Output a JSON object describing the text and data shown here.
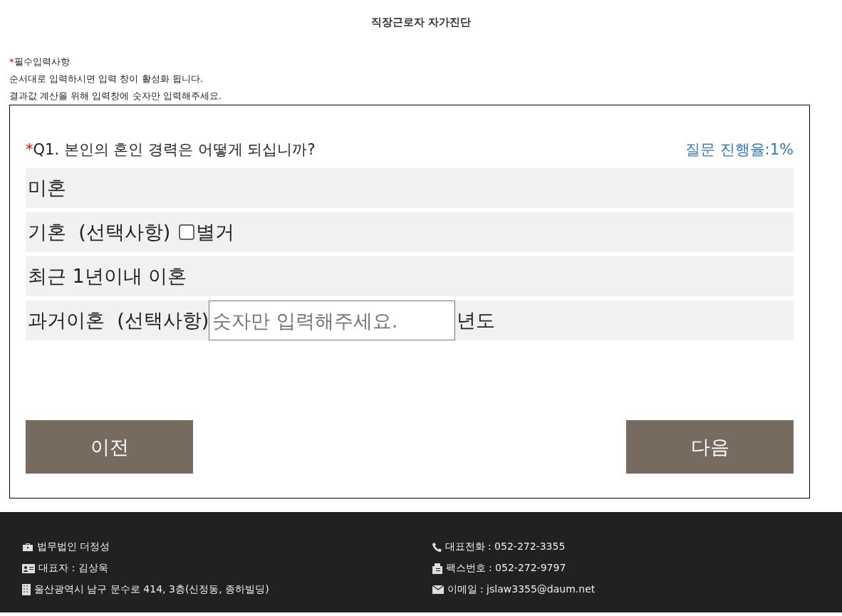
{
  "page_title": "직장근로자 자가진단",
  "notes": {
    "required_mark": "*",
    "required_label": "필수입력사항",
    "lines": [
      "순서대로 입력하시면 입력 창이 활성화 됩니다.",
      "결과값 계산을 위해 입력창에 숫자만 입력해주세요."
    ]
  },
  "question": {
    "required_mark": "*",
    "text": "Q1. 본인의 혼인 경력은 어떻게 되십니까?",
    "progress": "질문 진행율:1%"
  },
  "options": [
    {
      "kind": "plain",
      "label": "미혼"
    },
    {
      "kind": "checkbox",
      "label": "기혼  (선택사항)",
      "checkbox_label": "별거",
      "checked": false
    },
    {
      "kind": "plain",
      "label": "최근 1년이내 이혼"
    },
    {
      "kind": "input",
      "label": "과거이혼  (선택사항)",
      "placeholder": "숫자만 입력해주세요.",
      "suffix": "년도"
    }
  ],
  "buttons": {
    "prev": "이전",
    "next": "다음"
  },
  "footer": {
    "left": [
      {
        "kind": "briefcase",
        "text": "법무법인 더정성"
      },
      {
        "kind": "idcard",
        "text": "대표자 : 김상욱"
      },
      {
        "kind": "building",
        "text": "울산광역시 남구 문수로 414, 3층(신정동, 종하빌딩)"
      }
    ],
    "right": [
      {
        "kind": "phone",
        "text": "대표전화 : 052-272-3355"
      },
      {
        "kind": "fax",
        "text": "팩스번호 : 052-272-9797"
      },
      {
        "kind": "mail",
        "text": "이메일 : jslaw3355@daum.net"
      }
    ]
  }
}
